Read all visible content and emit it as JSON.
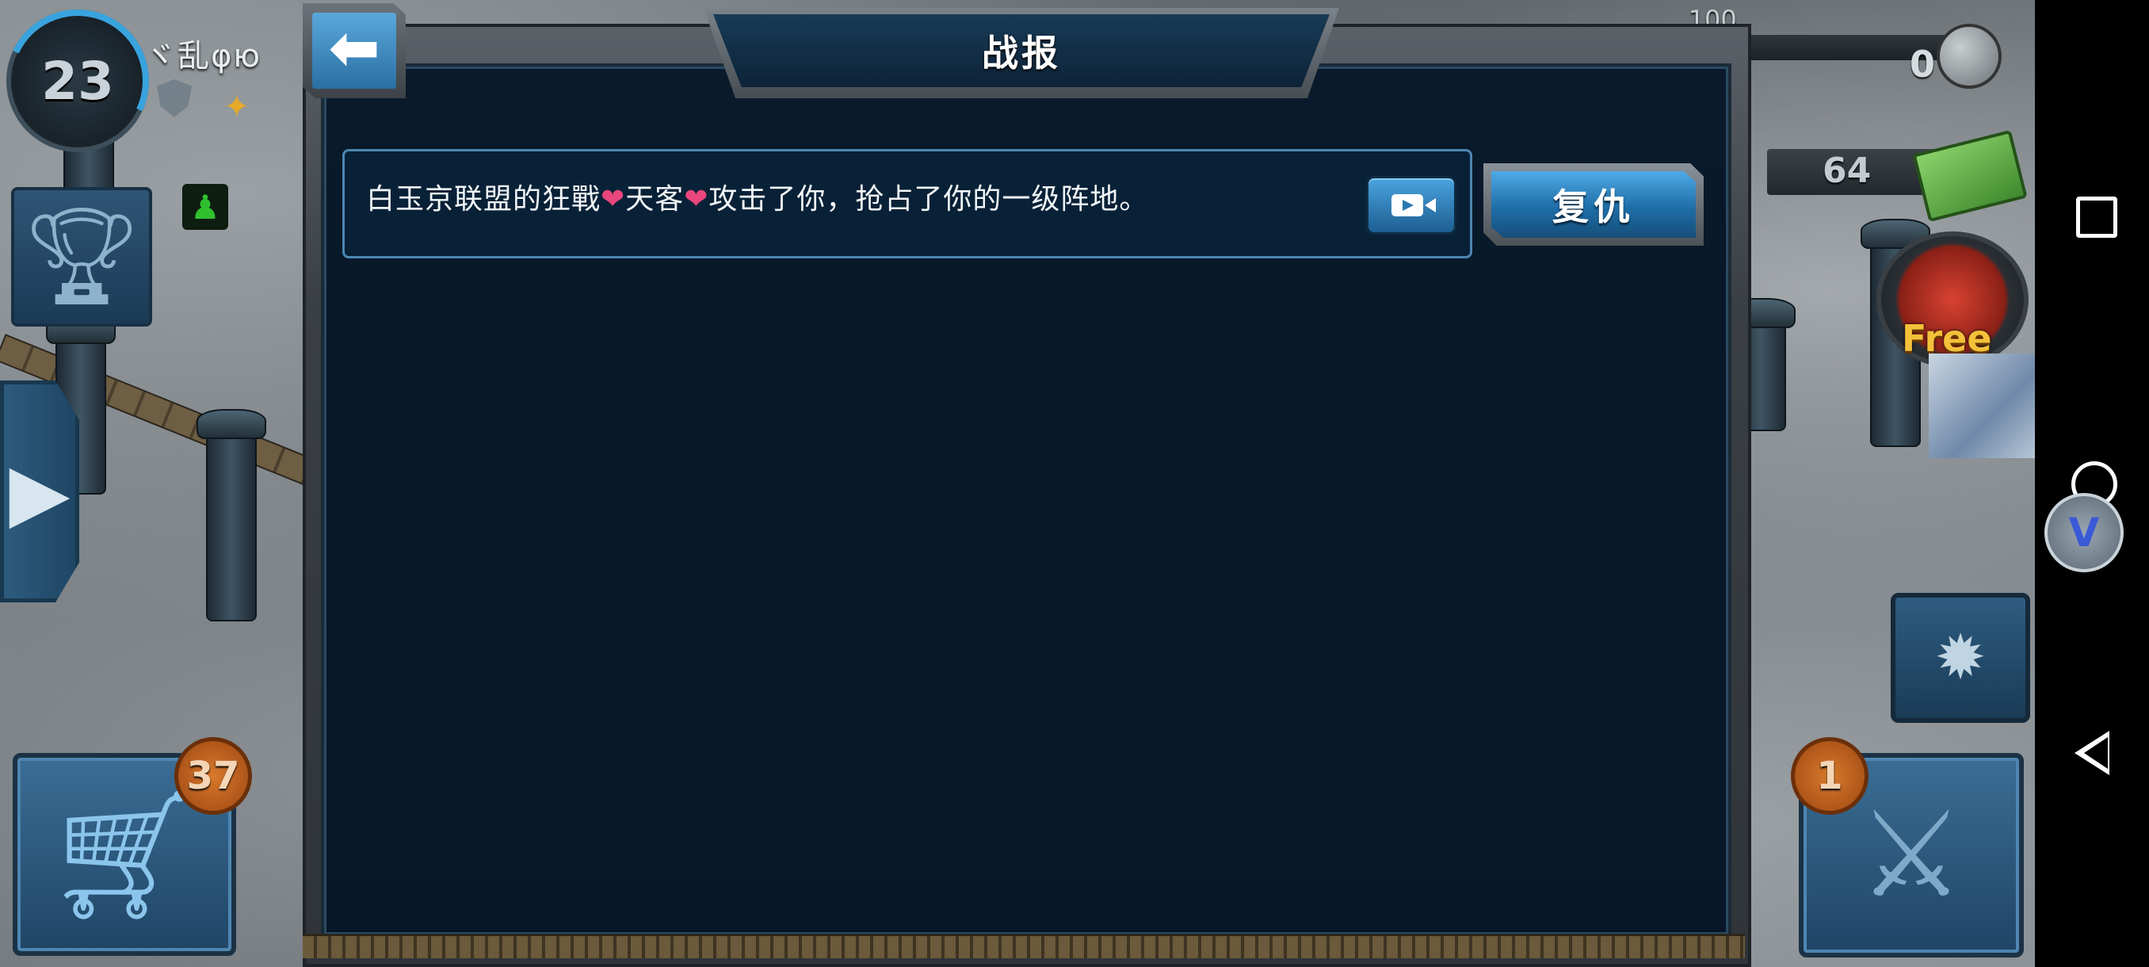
{
  "hud": {
    "player_level": "23",
    "player_name": "ヾ乱φю",
    "shop_badge_count": "37",
    "attack_badge_count": "1",
    "resource_top_max": "...,100",
    "resource_top_value": "0",
    "cash_value": "64",
    "gift_label": "Free"
  },
  "dialog": {
    "title": "战报",
    "reports": [
      {
        "message_part1": "白玉京联盟的狂戰",
        "message_part2": "天客",
        "message_part3": "攻击了你，抢占了你的一级阵地。",
        "heart_glyph": "❤",
        "revenge_label": "复仇"
      }
    ]
  },
  "icons": {
    "back": "back-arrow-icon",
    "replay": "video-camera-icon",
    "shop": "shopping-cart-icon",
    "trophy": "trophy-icon",
    "attack": "crossed-rifles-icon"
  },
  "colors": {
    "dialog_bg": "#04162a",
    "accent_blue": "#2a6fa2",
    "heart_pink": "#e8467d",
    "badge_orange": "#d87a2c"
  }
}
